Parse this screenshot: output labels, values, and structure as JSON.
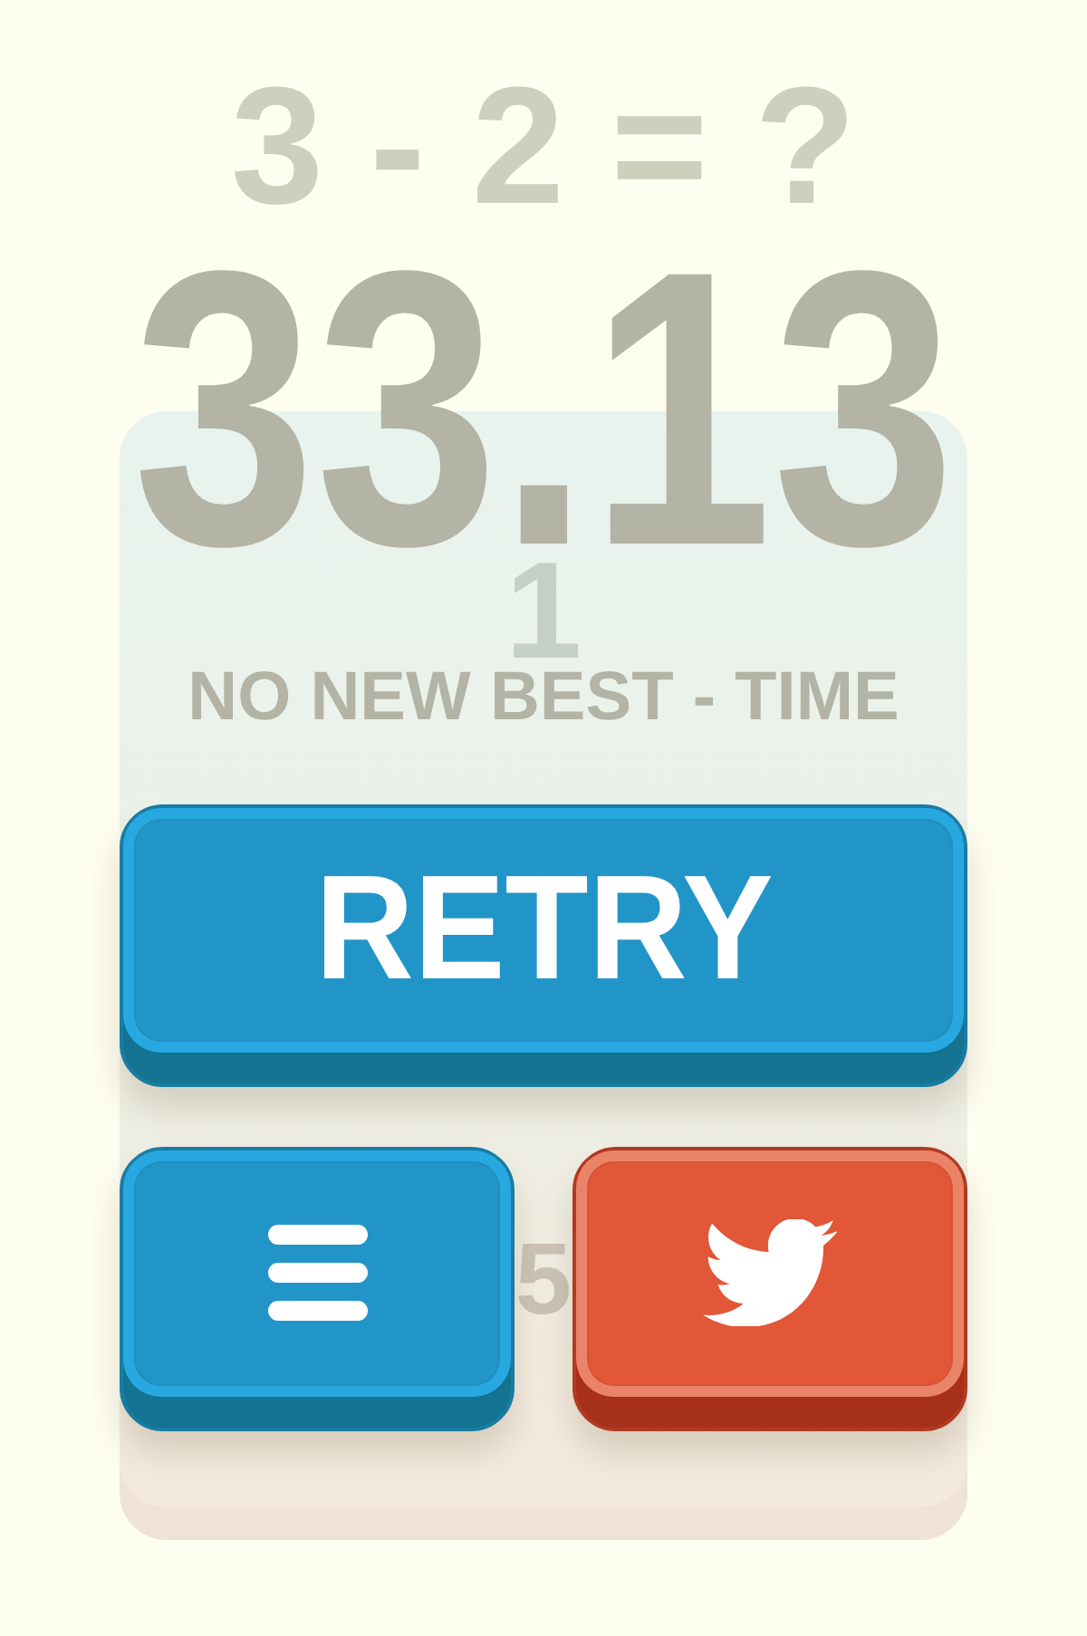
{
  "faded_game": {
    "equation": "3 - 2 = ?",
    "tile_upper": "1",
    "tile_lower": "5"
  },
  "result": {
    "time": "33.13",
    "message": "NO NEW BEST - TIME"
  },
  "retry_button": {
    "label": "RETRY"
  },
  "bottom_buttons": [
    {
      "kind": "menu"
    },
    {
      "kind": "share"
    }
  ]
}
